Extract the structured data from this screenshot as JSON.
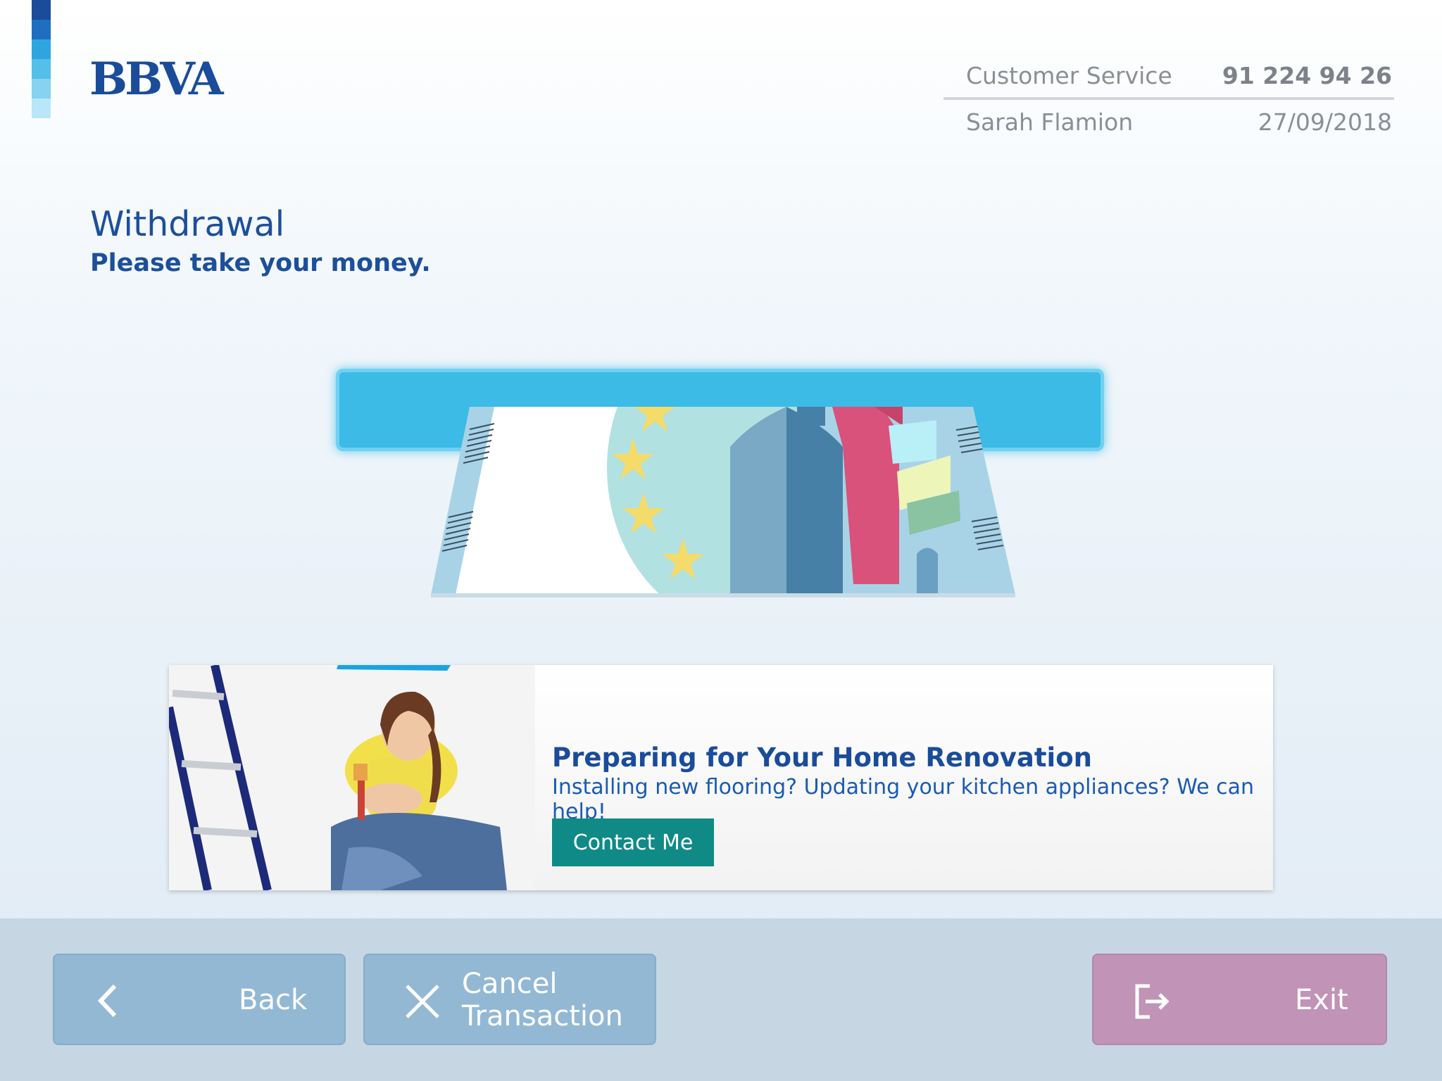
{
  "brand": {
    "logo_text": "BBVA",
    "bar_colors": [
      "#1a4c9a",
      "#1f6ec0",
      "#2fa5e0",
      "#54bfe8",
      "#86d2f0",
      "#b9e6f8"
    ]
  },
  "header": {
    "customer_service_label": "Customer Service",
    "customer_service_phone": "91 224 94 26",
    "user_name": "Sarah Flamion",
    "date": "27/09/2018"
  },
  "main": {
    "title": "Withdrawal",
    "subtitle": "Please take your money."
  },
  "ad": {
    "title": "Preparing for Your Home Renovation",
    "text": "Installing new flooring? Updating your kitchen appliances? We can help!",
    "button_label": "Contact Me"
  },
  "footer": {
    "back_label": "Back",
    "cancel_label_line1": "Cancel",
    "cancel_label_line2": "Transaction",
    "exit_label": "Exit"
  },
  "colors": {
    "brand_blue": "#1a4c9a",
    "slot_blue": "#3bbbe6",
    "ad_button": "#0f8a87",
    "footer_button_blue": "#93b8d4",
    "footer_button_pink": "#c193b7"
  }
}
